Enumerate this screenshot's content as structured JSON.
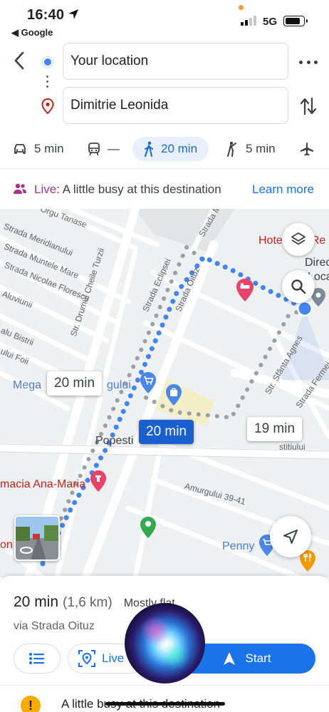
{
  "status_bar": {
    "time": "16:40",
    "back_app": "◀ Google",
    "network": "5G",
    "icons": [
      "location-arrow-icon",
      "signal-icon",
      "battery-icon"
    ]
  },
  "route": {
    "origin": "Your location",
    "destination": "Dimitrie Leonida",
    "icons": [
      "back-arrow-icon",
      "origin-dot-icon",
      "destination-pin-icon",
      "more-icon",
      "swap-icon"
    ]
  },
  "modes": [
    {
      "icon": "car-icon",
      "label": "5 min"
    },
    {
      "icon": "transit-icon",
      "label": "—"
    },
    {
      "icon": "walk-icon",
      "label": "20 min",
      "active": true
    },
    {
      "icon": "ride-icon",
      "label": "5 min"
    },
    {
      "icon": "flight-icon",
      "label": ""
    }
  ],
  "live": {
    "prefix": "Live",
    "text": ": A little busy at this destination",
    "link": "Learn more"
  },
  "map": {
    "streets": [
      "Orgu Tanase",
      "Strada Meridianului",
      "Strada Muntele Mare",
      "Strada Nicolae Florescu",
      "Aluviunii",
      "alu Bistrii",
      "ului Foii",
      "Str. Drumul Cheile Turzii",
      "Strada Eclipsei",
      "Strada Oituz",
      "Strada M",
      "Str. Sfânta Agnes",
      "Strada Fermei",
      "stitiului",
      "Amurgului 39-41"
    ],
    "places": {
      "hotel": "Hotel Ana Re",
      "direc": "Direc",
      "loca": "Loca",
      "mega": "Mega",
      "gului": "gului",
      "popesti": "Popesti",
      "farmacia": "macia Ana-Maria",
      "penny": "Penny",
      "on": "on"
    },
    "bubbles": {
      "left": "20 min",
      "selected": "20 min",
      "right": "19 min"
    }
  },
  "sheet": {
    "duration": "20 min",
    "distance": "(1,6 km)",
    "terrain": "Mostly flat",
    "via": "via Strada Oituz",
    "live_label": "Live",
    "start_label": "Start",
    "notice": "A little busy at this destination"
  },
  "colors": {
    "accent": "#1a73e8",
    "route_blue": "#4285f4",
    "alt_route_gray": "#9aa0a6",
    "live_purple": "#a3338c",
    "warning": "#f9ab00"
  }
}
